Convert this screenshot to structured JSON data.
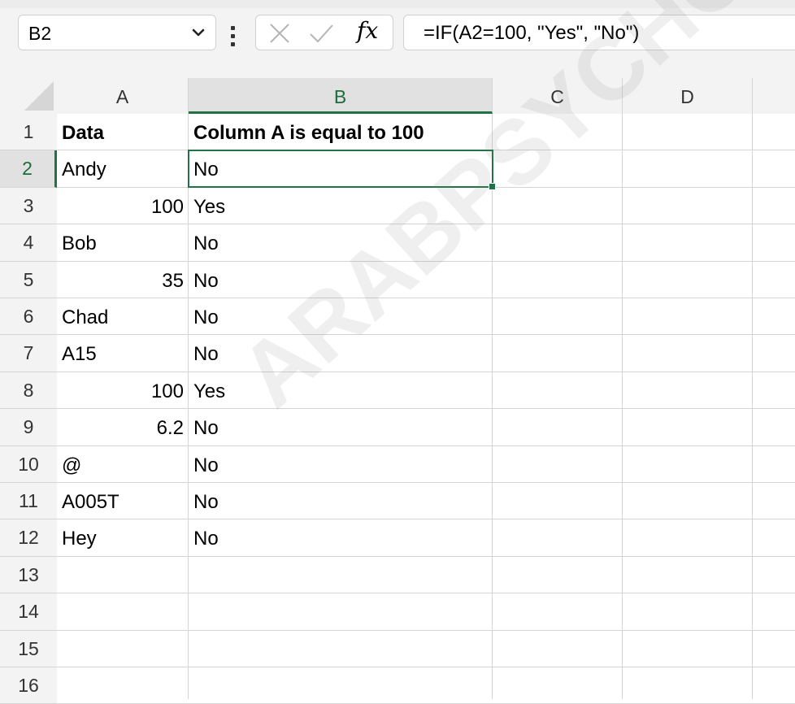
{
  "formula_bar": {
    "name_box": "B2",
    "formula": "=IF(A2=100, \"Yes\", \"No\")",
    "cancel_icon": "x-icon",
    "enter_icon": "check-icon",
    "fx_label": "fx"
  },
  "columns": [
    "A",
    "B",
    "C",
    "D"
  ],
  "rows": [
    "1",
    "2",
    "3",
    "4",
    "5",
    "6",
    "7",
    "8",
    "9",
    "10",
    "11",
    "12",
    "13",
    "14",
    "15",
    "16"
  ],
  "cells": {
    "A1": "Data",
    "B1": "Column A is equal to 100",
    "A2": "Andy",
    "B2": "No",
    "A3": "100",
    "B3": "Yes",
    "A4": "Bob",
    "B4": "No",
    "A5": "35",
    "B5": "No",
    "A6": "Chad",
    "B6": "No",
    "A7": "A15",
    "B7": "No",
    "A8": "100",
    "B8": "Yes",
    "A9": "6.2",
    "B9": "No",
    "A10": "@",
    "B10": "No",
    "A11": "A005T",
    "B11": "No",
    "A12": "Hey",
    "B12": "No"
  },
  "selected_cell": "B2",
  "watermark": "ARABPSYCHOLOGY",
  "colors": {
    "accent": "#217346",
    "header_bg": "#f3f3f3",
    "gridline": "#d4d4d4"
  }
}
